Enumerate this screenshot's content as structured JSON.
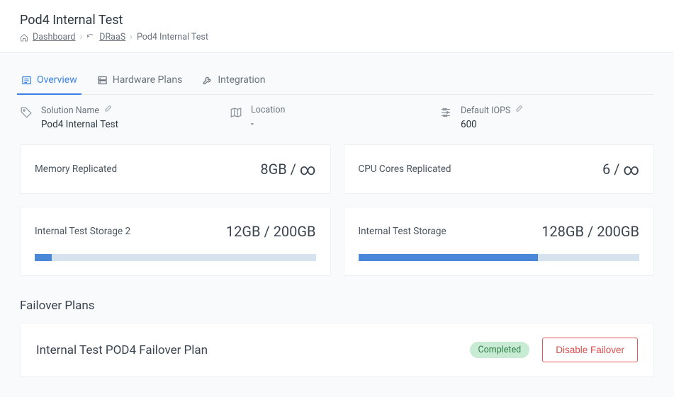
{
  "header": {
    "title": "Pod4 Internal Test",
    "breadcrumb": {
      "dashboard": "Dashboard",
      "draas": "DRaaS",
      "current": "Pod4 Internal Test"
    }
  },
  "tabs": {
    "overview": "Overview",
    "hardware_plans": "Hardware Plans",
    "integration": "Integration"
  },
  "overview": {
    "solution_name": {
      "label": "Solution Name",
      "value": "Pod4 Internal Test"
    },
    "location": {
      "label": "Location",
      "value": "-"
    },
    "default_iops": {
      "label": "Default IOPS",
      "value": "600"
    }
  },
  "stats": {
    "memory": {
      "label": "Memory Replicated",
      "value": "8GB",
      "max": "∞"
    },
    "cpu": {
      "label": "CPU Cores Replicated",
      "value": "6",
      "max": "∞"
    },
    "storage2": {
      "label": "Internal Test Storage 2",
      "value": "12GB",
      "max": "200GB",
      "percent": 6
    },
    "storage1": {
      "label": "Internal Test Storage",
      "value": "128GB",
      "max": "200GB",
      "percent": 64
    }
  },
  "failover": {
    "section_title": "Failover Plans",
    "plan_name": "Internal Test POD4 Failover Plan",
    "status": "Completed",
    "disable_label": "Disable Failover"
  }
}
